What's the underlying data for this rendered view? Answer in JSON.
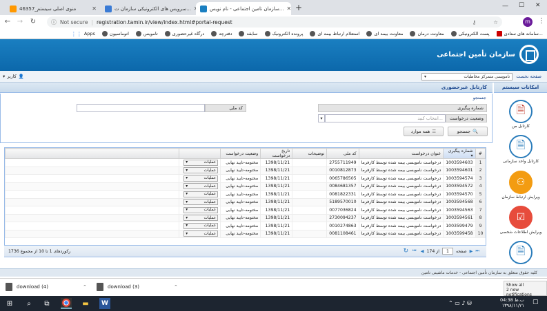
{
  "browser": {
    "tabs": [
      {
        "title": "46357_منوی اصلی سیستم"
      },
      {
        "title": "سرویس های الکترونیکی سازمان ت..."
      },
      {
        "title": "سازمان تامین اجتماعی - نام نویس..."
      }
    ],
    "security": "Not secure",
    "url": "registration.tamin.ir/view/index.html#portal-request",
    "avatar_letter": "m",
    "bookmarks": [
      "Apps",
      "اتوماسیون",
      "تامویس",
      "درگاه غیرحضوری",
      "دفترچه",
      "سابقه",
      "پرونده الکترونیک",
      "استعلام ارتباط بیمه ای",
      "معاونت بیمه ای",
      "معاونت درمان",
      "پست الکترونیکی",
      "سامانه های ستادی..."
    ]
  },
  "app": {
    "logo_text": "سازمان تأمین اجتماعی",
    "home_link": "صفحه نخست",
    "branch_select": "نامویسی متمرکز مخاطبات",
    "user_label": "کاربر",
    "side_title": "امکانات سیستم",
    "panel_title": "کارتابل غیرحضوری"
  },
  "search": {
    "title": "جستجو",
    "tracking_label": "شماره پیگیری",
    "national_code_label": "کد ملی",
    "status_label": "وضعیت درخواست",
    "status_placeholder": "انتخاب کنید...",
    "search_button": "جستجو",
    "all_button": "همه موارد"
  },
  "grid": {
    "headers": [
      "#",
      "شماره پیگیری",
      "عنوان درخواست",
      "کد ملی",
      "توضیحات",
      "تاریخ درخواست",
      "وضعیت درخواست"
    ],
    "rows": [
      {
        "n": "1",
        "track": "1003594603",
        "title": "درخواست نامویسی بیمه شده توسط کارفرما",
        "nid": "2755711949",
        "desc": "",
        "date": "1398/11/21",
        "status": "مختومه-تایید نهایی",
        "op": "عملیات"
      },
      {
        "n": "2",
        "track": "1003594601",
        "title": "درخواست نامویسی بیمه شده توسط کارفرما",
        "nid": "0010812873",
        "desc": "",
        "date": "1398/11/21",
        "status": "مختومه-تایید نهایی",
        "op": "عملیات"
      },
      {
        "n": "3",
        "track": "1003594574",
        "title": "درخواست نامویسی بیمه شده توسط کارفرما",
        "nid": "0065786505",
        "desc": "",
        "date": "1398/11/21",
        "status": "مختومه-تایید نهایی",
        "op": "عملیات"
      },
      {
        "n": "4",
        "track": "1003594572",
        "title": "درخواست نامویسی بیمه شده توسط کارفرما",
        "nid": "0084681357",
        "desc": "",
        "date": "1398/11/21",
        "status": "مختومه-تایید نهایی",
        "op": "عملیات"
      },
      {
        "n": "5",
        "track": "1003594570",
        "title": "درخواست نامویسی بیمه شده توسط کارفرما",
        "nid": "0081822331",
        "desc": "",
        "date": "1398/11/21",
        "status": "مختومه-تایید نهایی",
        "op": "عملیات"
      },
      {
        "n": "6",
        "track": "1003594568",
        "title": "درخواست نامویسی بیمه شده توسط کارفرما",
        "nid": "5189570010",
        "desc": "",
        "date": "1398/11/21",
        "status": "مختومه-تایید نهایی",
        "op": "عملیات"
      },
      {
        "n": "7",
        "track": "1003594563",
        "title": "درخواست نامویسی بیمه شده توسط کارفرما",
        "nid": "0077036824",
        "desc": "",
        "date": "1398/11/21",
        "status": "مختومه-تایید نهایی",
        "op": "عملیات"
      },
      {
        "n": "8",
        "track": "1003594561",
        "title": "درخواست نامویسی بیمه شده توسط کارفرما",
        "nid": "2730094237",
        "desc": "",
        "date": "1398/11/21",
        "status": "مختومه-تایید نهایی",
        "op": "عملیات"
      },
      {
        "n": "9",
        "track": "1003599479",
        "title": "درخواست نامویسی بیمه شده توسط کارفرما",
        "nid": "0010274863",
        "desc": "",
        "date": "1398/11/21",
        "status": "مختومه-تایید نهایی",
        "op": "عملیات"
      },
      {
        "n": "10",
        "track": "1003599458",
        "title": "درخواست نامویسی بیمه شده توسط کارفرما",
        "nid": "0081108461",
        "desc": "",
        "date": "1398/11/21",
        "status": "مختومه-تایید نهایی",
        "op": "عملیات"
      }
    ]
  },
  "pager": {
    "page_label": "صفحه",
    "page_value": "1",
    "of_label": "از 174",
    "summary": "رکوردهای 1 تا 10 از مجموع 1736"
  },
  "side_menu": [
    {
      "label": "کارتابل من"
    },
    {
      "label": "کارتابل واحد سازمانی"
    },
    {
      "label": "ویرایش ارتباط سازمان"
    },
    {
      "label": "ویرایش اطلاعات شخصی"
    },
    {
      "label": ""
    }
  ],
  "footer_text": "کلیه حقوق متعلق به سازمان تأمین اجتماعی - خدمات ماشینی تامین",
  "downloads": [
    {
      "name": "download (4)"
    },
    {
      "name": "download (3)"
    }
  ],
  "show_all": "Show all",
  "notifications": "2 new notifications",
  "clock": {
    "time": "04:38 ب.ظ",
    "date": "۱۳۹۸/۱۱/۲۱"
  }
}
